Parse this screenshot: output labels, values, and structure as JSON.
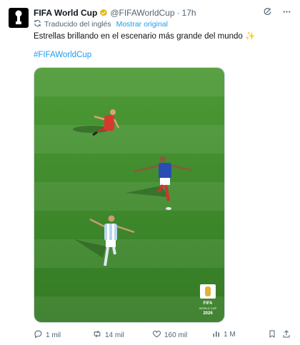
{
  "tweet": {
    "display_name": "FIFA World Cup",
    "handle": "@FIFAWorldCup",
    "separator": "·",
    "time": "17h",
    "translated_label": "Traducido del inglés",
    "show_original": "Mostrar original",
    "text": "Estrellas brillando en el escenario más grande del mundo",
    "text_emoji": "✨",
    "hashtag": "#FIFAWorldCup",
    "media_logo": {
      "brand": "FIFA",
      "line1": "WORLD CUP",
      "line2": "2026"
    }
  },
  "actions": {
    "replies": "1 mil",
    "reposts": "14 mil",
    "likes": "160 mil",
    "views": "1 M"
  },
  "icons": {
    "verified": "verified-badge-icon",
    "grok": "grok-icon",
    "more": "more-icon",
    "translate": "translate-icon",
    "reply": "reply-icon",
    "repost": "repost-icon",
    "like": "heart-icon",
    "views": "views-icon",
    "bookmark": "bookmark-icon",
    "share": "share-icon"
  },
  "colors": {
    "accent": "#1d9bf0",
    "verified_gold": "#e2b719",
    "text_primary": "#0f1419",
    "text_secondary": "#536471",
    "pitch": "#3f8a2c"
  }
}
